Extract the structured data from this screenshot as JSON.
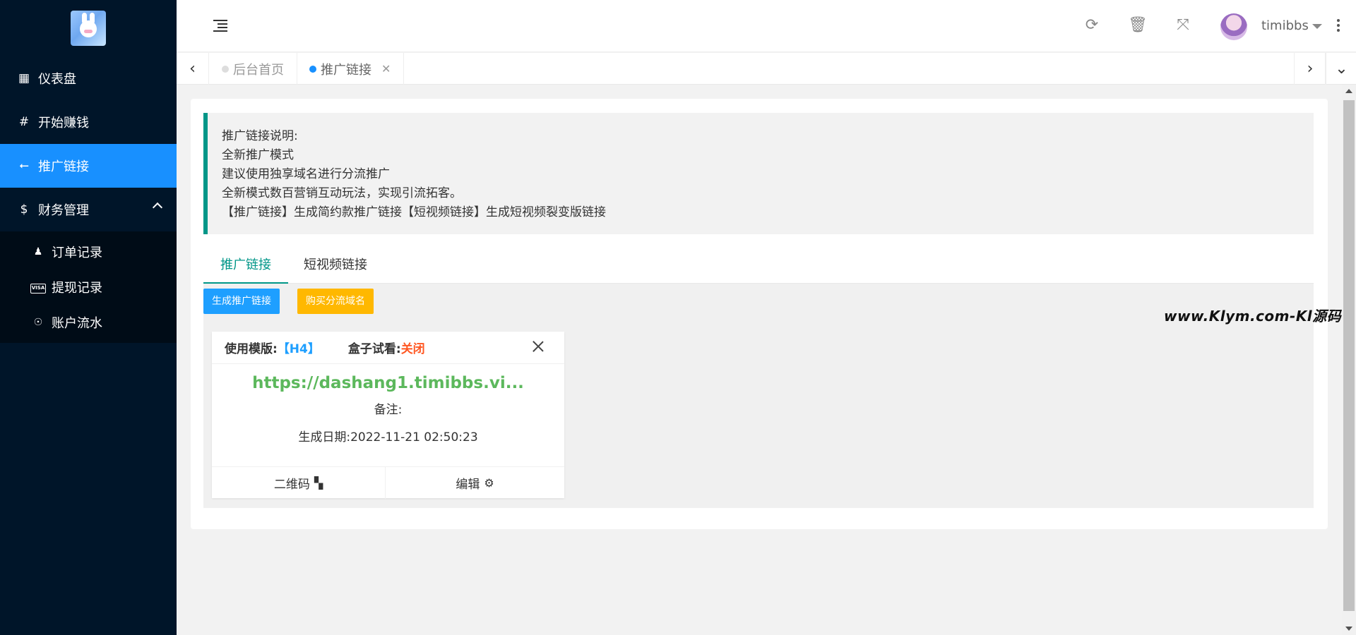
{
  "sidebar": {
    "items": [
      {
        "label": "仪表盘",
        "icon": "building-icon"
      },
      {
        "label": "开始赚钱",
        "icon": "hash-icon"
      },
      {
        "label": "推广链接",
        "icon": "usb-icon"
      },
      {
        "label": "财务管理",
        "icon": "dollar-icon"
      }
    ],
    "submenu": [
      {
        "label": "订单记录",
        "icon": "user-icon"
      },
      {
        "label": "提现记录",
        "icon": "visa-icon",
        "icon_text": "VISA"
      },
      {
        "label": "账户流水",
        "icon": "accessibility-icon"
      }
    ]
  },
  "header": {
    "username": "timibbs",
    "icons": [
      "refresh-icon",
      "trash-icon",
      "fullscreen-icon",
      "more-icon"
    ]
  },
  "tabsbar": {
    "tabs": [
      {
        "label": "后台首页"
      },
      {
        "label": "推广链接"
      }
    ]
  },
  "notice": {
    "lines": [
      "推广链接说明:",
      "全新推广模式",
      "建议使用独享域名进行分流推广",
      "全新模式数百营销互动玩法，实现引流拓客。",
      "【推广链接】生成简约款推广链接【短视频链接】生成短视频裂变版链接"
    ]
  },
  "tabs": [
    {
      "label": "推广链接"
    },
    {
      "label": "短视频链接"
    }
  ],
  "buttons": {
    "generate": "生成推广链接",
    "buy_domain": "购买分流域名"
  },
  "card": {
    "template_label": "使用模版:",
    "template_value": "【H4】",
    "box_label": "盒子试看:",
    "box_value": "关闭",
    "url": "https://dashang1.timibbs.vi...",
    "note": "备注:",
    "date": "生成日期:2022-11-21 02:50:23",
    "qr_label": "二维码",
    "edit_label": "编辑"
  },
  "watermark": "www.Klym.com-Kl源码",
  "colors": {
    "sidebar_bg": "#001529",
    "active_blue": "#1890ff",
    "teal": "#009688",
    "button_blue": "#1e9fff",
    "button_yellow": "#ffb800",
    "url_green": "#5cb85c",
    "closed_red": "#ff5722"
  }
}
